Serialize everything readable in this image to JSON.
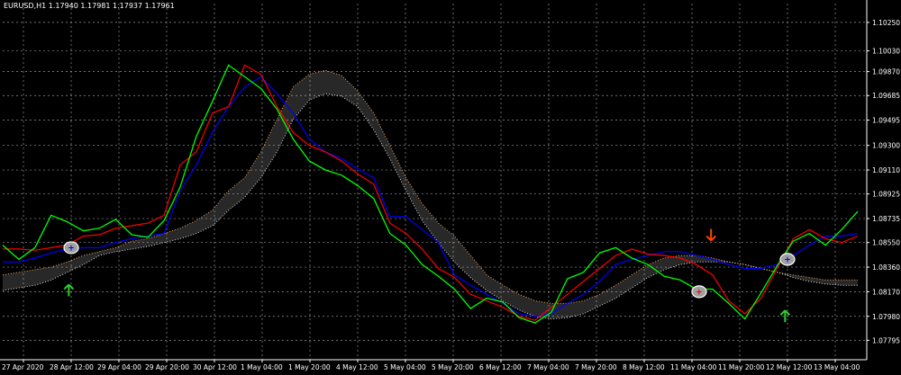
{
  "window": {
    "symbol_label": "EURUSD,H1",
    "ohlc_label": "1.17940 1.17981 1.17937 1.17961"
  },
  "colors": {
    "background": "#000000",
    "grid": "#c8c8c8",
    "price_line": "#00ff00",
    "tenkan": "#ff0000",
    "kijun": "#0000ff",
    "cloud_a": "#f4a460",
    "cloud_b": "#dcdcdc",
    "text": "#ffffff",
    "arrow_sell": "#ff4500",
    "arrow_buy": "#32cd32",
    "marker_fill": "#9f9f9f",
    "marker_text_buy": "#0000ff",
    "marker_text_sell": "#ff0000"
  },
  "chart_data": {
    "type": "line",
    "title": "EURUSD,H1",
    "subtitle": "1.17940 1.17981 1.17937 1.17961",
    "grid": true,
    "ylim": [
      1.07645,
      1.10395
    ],
    "y_ticks": [
      "1.10250",
      "1.10030",
      "1.09870",
      "1.09685",
      "1.09495",
      "1.09300",
      "1.09110",
      "1.08925",
      "1.08735",
      "1.08550",
      "1.08360",
      "1.08170",
      "1.07980",
      "1.07795"
    ],
    "x_ticks": [
      "27 Apr 2020",
      "28 Apr 12:00",
      "29 Apr 04:00",
      "29 Apr 20:00",
      "30 Apr 12:00",
      "1 May 04:00",
      "1 May 20:00",
      "4 May 12:00",
      "5 May 04:00",
      "5 May 20:00",
      "6 May 12:00",
      "7 May 04:00",
      "7 May 20:00",
      "8 May 12:00",
      "11 May 04:00",
      "11 May 20:00",
      "12 May 12:00",
      "13 May 04:00"
    ],
    "x_count": 18,
    "series": [
      {
        "key": "price",
        "values": [
          1.0853,
          1.0842,
          1.0851,
          1.0876,
          1.0871,
          1.0864,
          1.0866,
          1.0873,
          1.0861,
          1.0859,
          1.0872,
          1.0898,
          1.0937,
          1.0964,
          1.0992,
          1.0983,
          1.0974,
          1.0958,
          1.0935,
          1.0918,
          1.0911,
          1.0907,
          1.0899,
          1.0889,
          1.0862,
          1.0853,
          1.0838,
          1.0829,
          1.0819,
          1.0804,
          1.0812,
          1.0809,
          1.0797,
          1.0793,
          1.0801,
          1.0827,
          1.0832,
          1.0847,
          1.0851,
          1.0843,
          1.0838,
          1.0829,
          1.0826,
          1.0819,
          1.0819,
          1.0808,
          1.0796,
          1.0816,
          1.0837,
          1.0856,
          1.0862,
          1.0853,
          1.0865,
          1.0879
        ]
      },
      {
        "key": "tenkan",
        "values": [
          1.085,
          1.085,
          1.0849,
          1.0851,
          1.0853,
          1.086,
          1.0861,
          1.0866,
          1.0868,
          1.087,
          1.0876,
          1.0915,
          1.0925,
          1.0955,
          1.096,
          1.0992,
          1.0985,
          1.096,
          1.094,
          1.093,
          1.0925,
          1.0918,
          1.0908,
          1.09,
          1.087,
          1.0862,
          1.085,
          1.0835,
          1.0828,
          1.0815,
          1.081,
          1.0805,
          1.0798,
          1.0795,
          1.0805,
          1.0815,
          1.0825,
          1.0835,
          1.0845,
          1.085,
          1.0846,
          1.0845,
          1.0843,
          1.0838,
          1.083,
          1.081,
          1.08,
          1.0812,
          1.0835,
          1.0858,
          1.0865,
          1.0858,
          1.0855,
          1.086
        ]
      },
      {
        "key": "kijun",
        "values": [
          1.084,
          1.084,
          1.0843,
          1.0847,
          1.085,
          1.0851,
          1.0851,
          1.0855,
          1.0858,
          1.086,
          1.0862,
          1.0895,
          1.0915,
          1.094,
          1.096,
          1.0975,
          1.0983,
          1.097,
          1.0955,
          1.0935,
          1.0925,
          1.092,
          1.0912,
          1.0905,
          1.0875,
          1.0875,
          1.0865,
          1.0855,
          1.083,
          1.0822,
          1.0815,
          1.0808,
          1.08,
          1.0798,
          1.08,
          1.0808,
          1.0815,
          1.0825,
          1.0838,
          1.0842,
          1.0845,
          1.0848,
          1.0848,
          1.0845,
          1.0842,
          1.0838,
          1.0835,
          1.0835,
          1.0838,
          1.0845,
          1.0853,
          1.086,
          1.086,
          1.0862
        ]
      },
      {
        "key": "span_a",
        "values": [
          1.083,
          1.0832,
          1.0834,
          1.0836,
          1.084,
          1.0845,
          1.0848,
          1.0851,
          1.0856,
          1.0858,
          1.0862,
          1.0866,
          1.0872,
          1.088,
          1.0895,
          1.0905,
          1.0925,
          1.095,
          1.0975,
          1.0985,
          1.0988,
          1.0984,
          1.0972,
          1.0955,
          1.093,
          1.0905,
          1.0885,
          1.087,
          1.086,
          1.0845,
          1.083,
          1.0822,
          1.0815,
          1.081,
          1.0808,
          1.0808,
          1.081,
          1.0815,
          1.0822,
          1.083,
          1.0838,
          1.0843,
          1.0845,
          1.0845,
          1.0843,
          1.084,
          1.0838,
          1.0835,
          1.0832,
          1.083,
          1.0828,
          1.0826,
          1.0826,
          1.0826
        ]
      },
      {
        "key": "span_b",
        "values": [
          1.0818,
          1.082,
          1.0822,
          1.0826,
          1.0832,
          1.0838,
          1.0845,
          1.0848,
          1.085,
          1.0852,
          1.0855,
          1.0858,
          1.0862,
          1.0868,
          1.088,
          1.089,
          1.0905,
          1.0925,
          1.095,
          1.0965,
          1.097,
          1.0968,
          1.096,
          1.0942,
          1.092,
          1.0895,
          1.0872,
          1.0855,
          1.084,
          1.0828,
          1.0818,
          1.081,
          1.0803,
          1.0798,
          1.0796,
          1.0797,
          1.08,
          1.0806,
          1.0812,
          1.082,
          1.0828,
          1.0834,
          1.0838,
          1.084,
          1.084,
          1.084,
          1.0838,
          1.0835,
          1.0832,
          1.0828,
          1.0825,
          1.0823,
          1.0822,
          1.0822
        ]
      }
    ],
    "markers": [
      {
        "type": "circle",
        "text": "+",
        "x": 1.0,
        "y": 1.0851,
        "side": "buy"
      },
      {
        "type": "circle",
        "text": "+",
        "x": 14.15,
        "y": 1.0817,
        "side": "sell"
      },
      {
        "type": "circle",
        "text": "+",
        "x": 16.0,
        "y": 1.0842,
        "side": "buy"
      },
      {
        "type": "arrow",
        "x": 0.95,
        "y": 1.0817,
        "dir": "up",
        "side": "buy"
      },
      {
        "type": "arrow",
        "x": 14.4,
        "y": 1.0862,
        "dir": "down",
        "side": "sell"
      },
      {
        "type": "arrow",
        "x": 15.95,
        "y": 1.0797,
        "dir": "up",
        "side": "buy"
      }
    ]
  }
}
